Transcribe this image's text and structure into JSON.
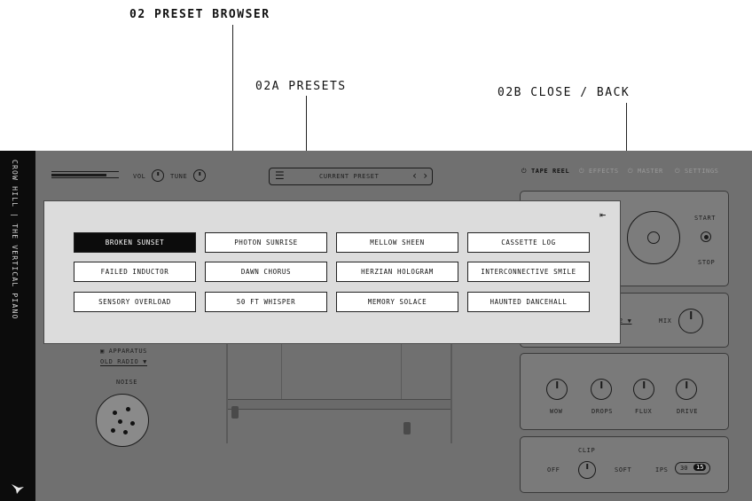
{
  "annotations": {
    "preset_browser": "02 PRESET BROWSER",
    "presets": "02A PRESETS",
    "close_back": "02B CLOSE / BACK"
  },
  "sidebar": {
    "title": "CROW HILL | THE VERTICAL PIANO"
  },
  "header": {
    "vol_label": "VOL",
    "tune_label": "TUNE",
    "preset_display": "CURRENT PRESET",
    "tabs": [
      "TAPE REEL",
      "EFFECTS",
      "MASTER",
      "SETTINGS"
    ]
  },
  "apparatus": {
    "label": "APPARATUS",
    "value": "OLD RADIO ▼",
    "noise_label": "NOISE"
  },
  "tape_reel": {
    "start_label": "START",
    "stop_label": "STOP"
  },
  "effects": {
    "select_value": "2 ▼",
    "mix_label": "MIX"
  },
  "master_knobs": [
    "WOW",
    "DROPS",
    "FLUX",
    "DRIVE"
  ],
  "clip": {
    "clip_label": "CLIP",
    "off_label": "OFF",
    "soft_label": "SOFT",
    "ips_label": "IPS",
    "ips_options": [
      "30",
      "15"
    ]
  },
  "preset_browser": {
    "presets": [
      [
        "BROKEN SUNSET",
        "PHOTON SUNRISE",
        "MELLOW SHEEN",
        "CASSETTE LOG"
      ],
      [
        "FAILED INDUCTOR",
        "DAWN CHORUS",
        "HERZIAN HOLOGRAM",
        "INTERCONNECTIVE SMILE"
      ],
      [
        "SENSORY OVERLOAD",
        "50 FT WHISPER",
        "MEMORY SOLACE",
        "HAUNTED DANCEHALL"
      ]
    ],
    "selected": "BROKEN SUNSET",
    "close_glyph": "⇤"
  },
  "colors": {
    "overlay": "#707070",
    "modal": "#dcdcdc",
    "selected": "#0c0c0c",
    "sidebar": "#0c0c0c"
  }
}
